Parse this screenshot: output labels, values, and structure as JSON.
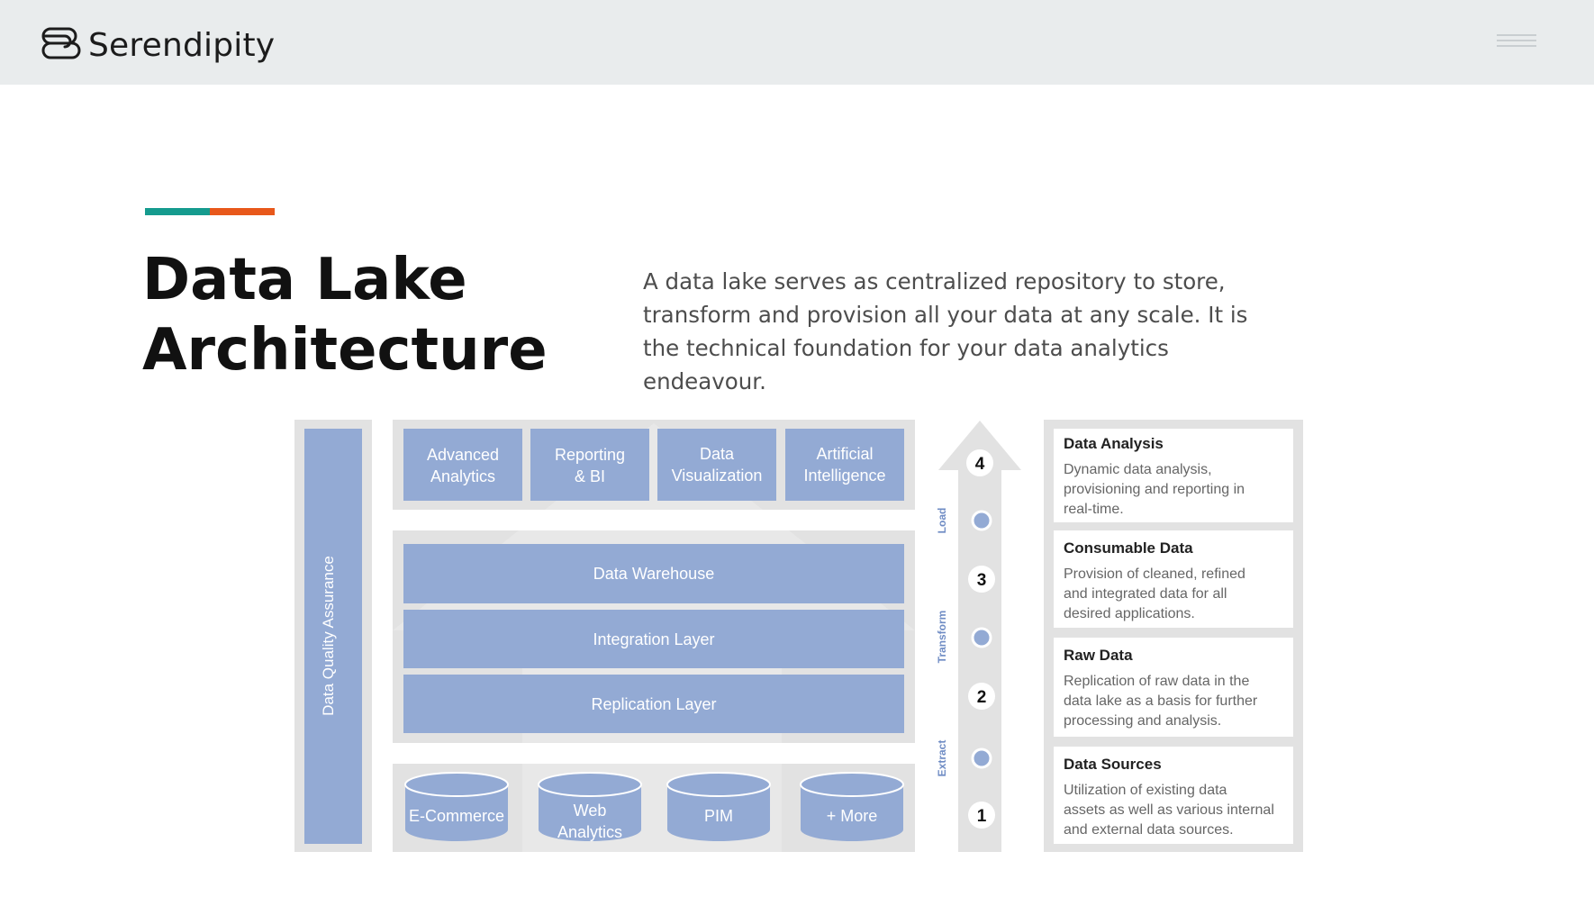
{
  "header": {
    "brand": "Serendipity",
    "logo_icon": "serendipity-logo-icon",
    "menu_icon": "hamburger-menu-icon"
  },
  "accent_colors": {
    "teal": "#159b8e",
    "orange": "#e8581b"
  },
  "hero": {
    "title_line1": "Data Lake",
    "title_line2": "Architecture",
    "description": "A data lake serves as centralized repository to store, transform and provision all your data at any scale. It is the technical foundation for your data analytics endeavour."
  },
  "diagram": {
    "box_color": "#93aad4",
    "quality_label": "Data Quality Assurance",
    "top_boxes": [
      {
        "line1": "Advanced",
        "line2": "Analytics"
      },
      {
        "line1": "Reporting",
        "line2": "& BI"
      },
      {
        "line1": "Data",
        "line2": "Visualization"
      },
      {
        "line1": "Artificial",
        "line2": "Intelligence"
      }
    ],
    "layers": [
      "Data Warehouse",
      "Integration Layer",
      "Replication Layer"
    ],
    "sources": [
      {
        "line1": "E-Commerce",
        "line2": ""
      },
      {
        "line1": "Web",
        "line2": "Analytics"
      },
      {
        "line1": "PIM",
        "line2": ""
      },
      {
        "line1": "+ More",
        "line2": ""
      }
    ],
    "steps": [
      "4",
      "3",
      "2",
      "1"
    ],
    "phases": [
      "Load",
      "Transform",
      "Extract"
    ],
    "legend": [
      {
        "title": "Data Analysis",
        "lines": [
          "Dynamic data analysis,",
          "provisioning and reporting in",
          "real-time."
        ]
      },
      {
        "title": "Consumable Data",
        "lines": [
          "Provision of cleaned, refined",
          "and integrated data for all",
          "desired applications."
        ]
      },
      {
        "title": "Raw Data",
        "lines": [
          "Replication of raw data in the",
          "data lake as a basis for further",
          "processing and analysis."
        ]
      },
      {
        "title": "Data Sources",
        "lines": [
          "Utilization of existing data",
          "assets as well as various internal",
          "and external data sources."
        ]
      }
    ]
  }
}
